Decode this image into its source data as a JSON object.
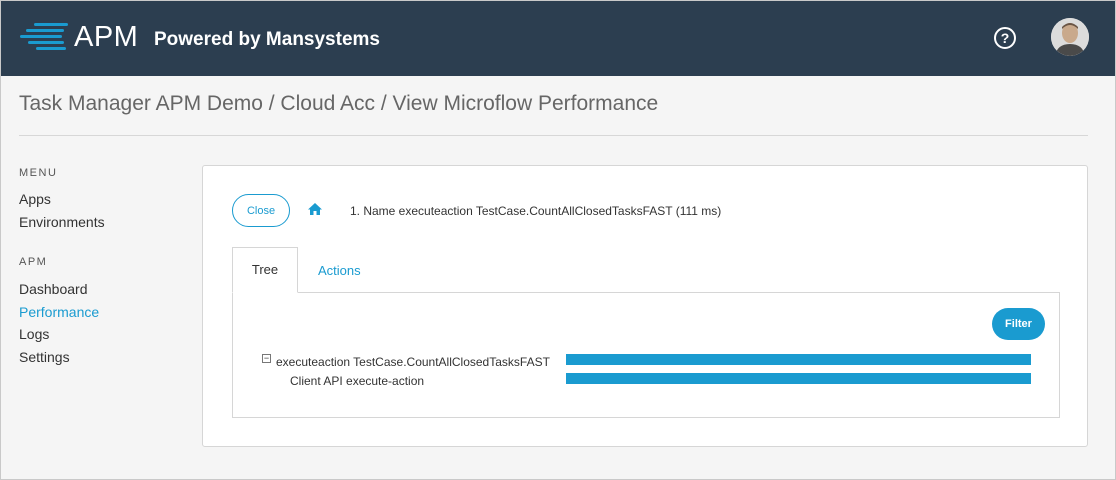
{
  "header": {
    "brand": "APM",
    "powered_by": "Powered by Mansystems",
    "help_glyph": "?",
    "colors": {
      "bar": "#2c3e50",
      "accent": "#1a9bd0"
    }
  },
  "breadcrumb": "Task Manager APM Demo / Cloud Acc / View Microflow Performance",
  "sidebar": {
    "menu_label": "MENU",
    "menu_items": [
      {
        "label": "Apps"
      },
      {
        "label": "Environments"
      }
    ],
    "apm_label": "APM",
    "apm_items": [
      {
        "label": "Dashboard"
      },
      {
        "label": "Performance",
        "active": true
      },
      {
        "label": "Logs"
      },
      {
        "label": "Settings"
      }
    ]
  },
  "panel": {
    "close_label": "Close",
    "home_icon": "home-icon",
    "crumb": "1. Name executeaction TestCase.CountAllClosedTasksFAST (111 ms)",
    "tabs": [
      {
        "label": "Tree",
        "active": true
      },
      {
        "label": "Actions"
      }
    ],
    "filter_label": "Filter",
    "toggle_glyph": "−",
    "tree": [
      {
        "label": "executeaction TestCase.CountAllClosedTasksFAST",
        "level": 0,
        "expanded": true
      },
      {
        "label": "Client API execute-action",
        "level": 1
      }
    ]
  }
}
